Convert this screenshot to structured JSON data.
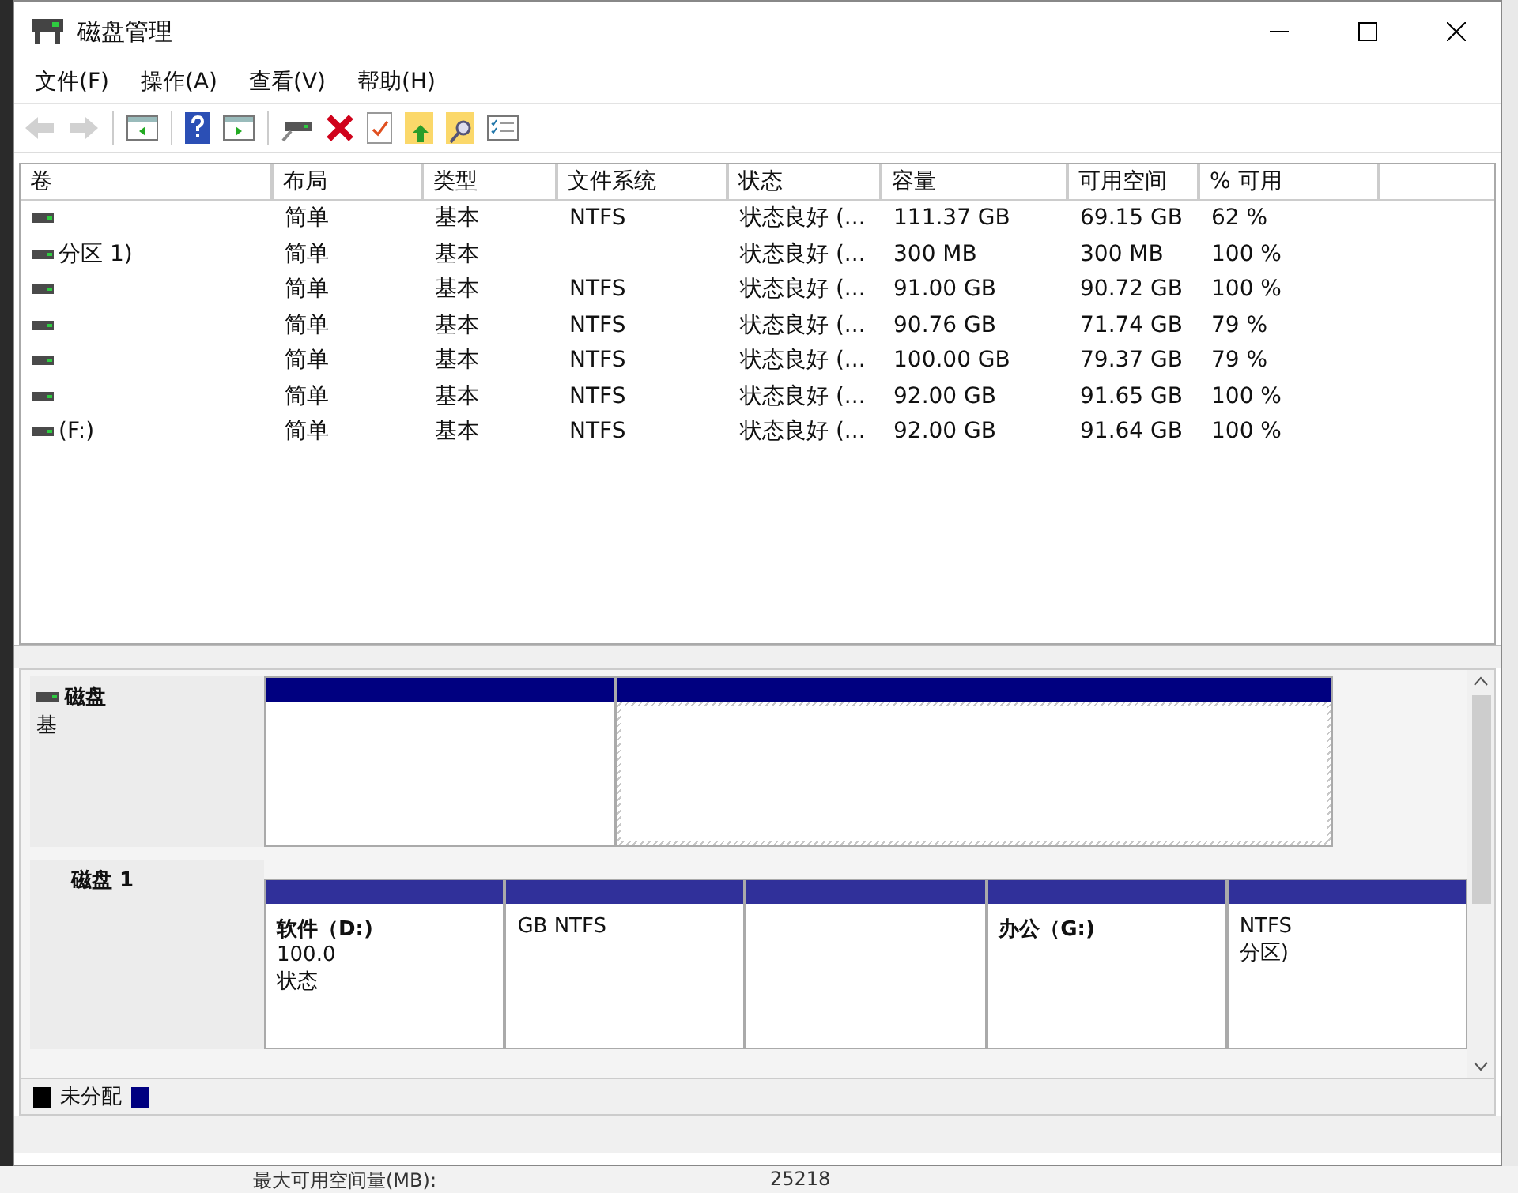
{
  "window": {
    "title": "磁盘管理"
  },
  "menu": [
    {
      "label": "文件(F)"
    },
    {
      "label": "操作(A)"
    },
    {
      "label": "查看(V)"
    },
    {
      "label": "帮助(H)"
    }
  ],
  "toolbar": [
    {
      "kind": "back",
      "disabled": true
    },
    {
      "kind": "forward",
      "disabled": true
    },
    {
      "kind": "sep"
    },
    {
      "kind": "panel-left",
      "disabled": false
    },
    {
      "kind": "sep"
    },
    {
      "kind": "help",
      "disabled": false
    },
    {
      "kind": "panel-right",
      "disabled": false
    },
    {
      "kind": "sep"
    },
    {
      "kind": "drive",
      "disabled": false
    },
    {
      "kind": "delete",
      "disabled": false
    },
    {
      "kind": "check",
      "disabled": false
    },
    {
      "kind": "folder-up",
      "disabled": false
    },
    {
      "kind": "folder-search",
      "disabled": false
    },
    {
      "kind": "list",
      "disabled": false
    }
  ],
  "table": {
    "columns": [
      "卷",
      "布局",
      "类型",
      "文件系统",
      "状态",
      "容量",
      "可用空间",
      "% 可用"
    ],
    "rows": [
      {
        "layout": "简单",
        "type": "基本",
        "fs": "NTFS",
        "status": "状态良好 (...",
        "capacity": "111.37 GB",
        "free": "69.15 GB",
        "pct": "62 %"
      },
      {
        "volume": "分区 1)",
        "layout": "简单",
        "type": "基本",
        "status": "状态良好 (...",
        "capacity": "300 MB",
        "free": "300 MB",
        "pct": "100 %"
      },
      {
        "layout": "简单",
        "type": "基本",
        "fs": "NTFS",
        "status": "状态良好 (...",
        "capacity": "91.00 GB",
        "free": "90.72 GB",
        "pct": "100 %"
      },
      {
        "layout": "简单",
        "type": "基本",
        "fs": "NTFS",
        "status": "状态良好 (...",
        "capacity": "90.76 GB",
        "free": "71.74 GB",
        "pct": "79 %"
      },
      {
        "layout": "简单",
        "type": "基本",
        "fs": "NTFS",
        "status": "状态良好 (...",
        "capacity": "100.00 GB",
        "free": "79.37 GB",
        "pct": "79 %"
      },
      {
        "layout": "简单",
        "type": "基本",
        "fs": "NTFS",
        "status": "状态良好 (...",
        "capacity": "92.00 GB",
        "free": "91.65 GB",
        "pct": "100 %"
      },
      {
        "volume": "(F:)",
        "layout": "简单",
        "type": "基本",
        "fs": "NTFS",
        "status": "状态良好 (...",
        "capacity": "92.00 GB",
        "free": "91.64 GB",
        "pct": "100 %"
      }
    ]
  },
  "disks": [
    {
      "label": "磁盘",
      "sub": "基",
      "partitions": [
        {
          "selected": false
        },
        {
          "selected": true
        }
      ]
    },
    {
      "label": "磁盘 1",
      "partitions": [
        {
          "selected": false,
          "name": "软件（D:)",
          "lines": [
            "100.0",
            "状态"
          ]
        },
        {
          "selected": false,
          "lines": [
            "GB NTFS"
          ]
        },
        {
          "selected": false
        },
        {
          "selected": false,
          "name": "办公（G:)"
        },
        {
          "selected": false,
          "lines": [
            "NTFS",
            "分区)"
          ]
        }
      ]
    }
  ],
  "legend": [
    {
      "label": "未分配",
      "color": "#000000"
    },
    {
      "color": "#000080"
    }
  ],
  "background_window": {
    "label": "最大可用空间量(MB):",
    "value": "25218"
  }
}
